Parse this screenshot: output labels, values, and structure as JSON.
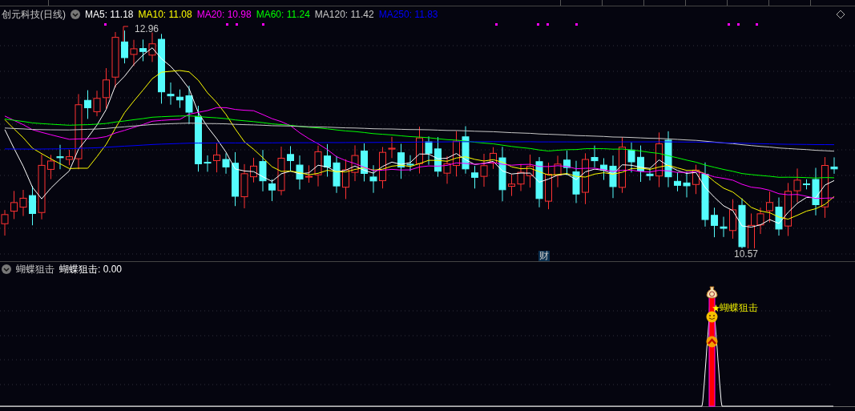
{
  "chart_header": {
    "stock": "创元科技(日线)",
    "ma": [
      {
        "label": "MA5: 11.18",
        "color": "#ffffff"
      },
      {
        "label": "MA10: 11.08",
        "color": "#ffff00"
      },
      {
        "label": "MA20: 10.98",
        "color": "#ff00ff"
      },
      {
        "label": "MA60: 11.24",
        "color": "#00ff00"
      },
      {
        "label": "MA120: 11.42",
        "color": "#c8c8c8"
      },
      {
        "label": "MA250: 11.83",
        "color": "#0000ff"
      }
    ]
  },
  "markers": {
    "high": "12.96",
    "low": "10.57",
    "finance_badge": "财"
  },
  "indicator": {
    "title": "蝴蝶狙击",
    "value": "蝴蝶狙击: 0.00",
    "signal_label": "蝴蝶狙击"
  }
}
